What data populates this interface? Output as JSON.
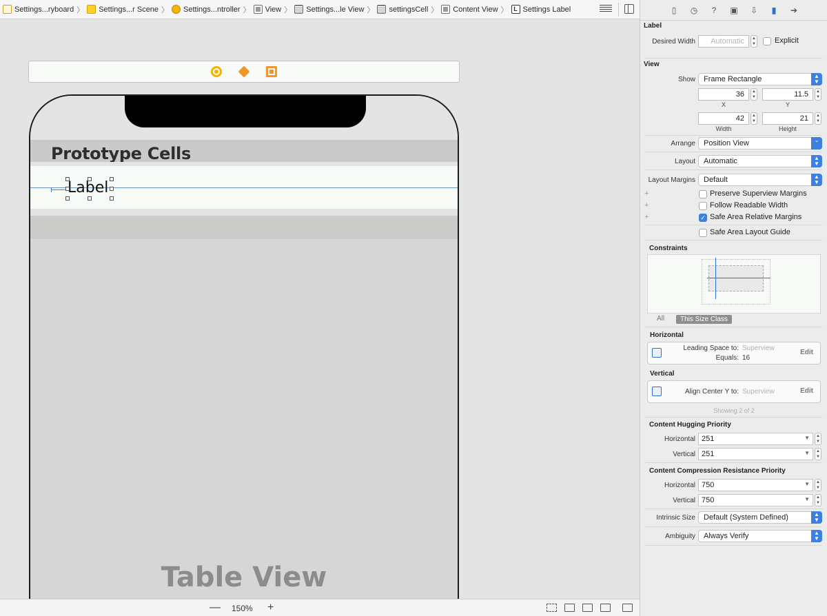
{
  "breadcrumb": [
    {
      "label": "Settings...ryboard",
      "icon": "storyboard-icon"
    },
    {
      "label": "Settings...r Scene",
      "icon": "scene-icon"
    },
    {
      "label": "Settings...ntroller",
      "icon": "view-controller-icon"
    },
    {
      "label": "View",
      "icon": "view-icon"
    },
    {
      "label": "Settings...le View",
      "icon": "table-view-icon"
    },
    {
      "label": "settingsCell",
      "icon": "table-cell-icon"
    },
    {
      "label": "Content View",
      "icon": "view-icon"
    },
    {
      "label": "Settings Label",
      "icon": "label-icon"
    }
  ],
  "canvas": {
    "section_title": "Prototype Cells",
    "cell_label": "Label",
    "table_view_watermark": "Table View",
    "zoom": "150%"
  },
  "inspector": {
    "label_section": {
      "title": "Label",
      "desired_width_label": "Desired Width",
      "desired_width_placeholder": "Automatic",
      "explicit_label": "Explicit",
      "explicit_checked": false
    },
    "view_section": {
      "title": "View",
      "show_label": "Show",
      "show_value": "Frame Rectangle",
      "x_value": "36",
      "y_value": "11.5",
      "x_label": "X",
      "y_label": "Y",
      "width_value": "42",
      "height_value": "21",
      "width_label": "Width",
      "height_label": "Height",
      "arrange_label": "Arrange",
      "arrange_value": "Position View",
      "layout_label": "Layout",
      "layout_value": "Automatic",
      "margins_label": "Layout Margins",
      "margins_value": "Default",
      "preserve_label": "Preserve Superview Margins",
      "preserve_checked": false,
      "readable_label": "Follow Readable Width",
      "readable_checked": false,
      "safe_margins_label": "Safe Area Relative Margins",
      "safe_margins_checked": true,
      "safe_guide_label": "Safe Area Layout Guide",
      "safe_guide_checked": false
    },
    "constraints": {
      "title": "Constraints",
      "seg_all": "All",
      "seg_size_class": "This Size Class",
      "horizontal_title": "Horizontal",
      "h_line1_label": "Leading Space to:",
      "h_line1_value": "Superview",
      "h_line2_label": "Equals:",
      "h_line2_value": "16",
      "edit": "Edit",
      "vertical_title": "Vertical",
      "v_line1_label": "Align Center Y to:",
      "v_line1_value": "Superview",
      "showing": "Showing 2 of 2"
    },
    "hugging": {
      "title": "Content Hugging Priority",
      "horizontal_label": "Horizontal",
      "horizontal_value": "251",
      "vertical_label": "Vertical",
      "vertical_value": "251"
    },
    "compression": {
      "title": "Content Compression Resistance Priority",
      "horizontal_label": "Horizontal",
      "horizontal_value": "750",
      "vertical_label": "Vertical",
      "vertical_value": "750"
    },
    "intrinsic": {
      "label": "Intrinsic Size",
      "value": "Default (System Defined)"
    },
    "ambiguity": {
      "label": "Ambiguity",
      "value": "Always Verify"
    }
  },
  "colors": {
    "accent": "#3b82e0",
    "constraint_blue": "#2c6fd6"
  }
}
